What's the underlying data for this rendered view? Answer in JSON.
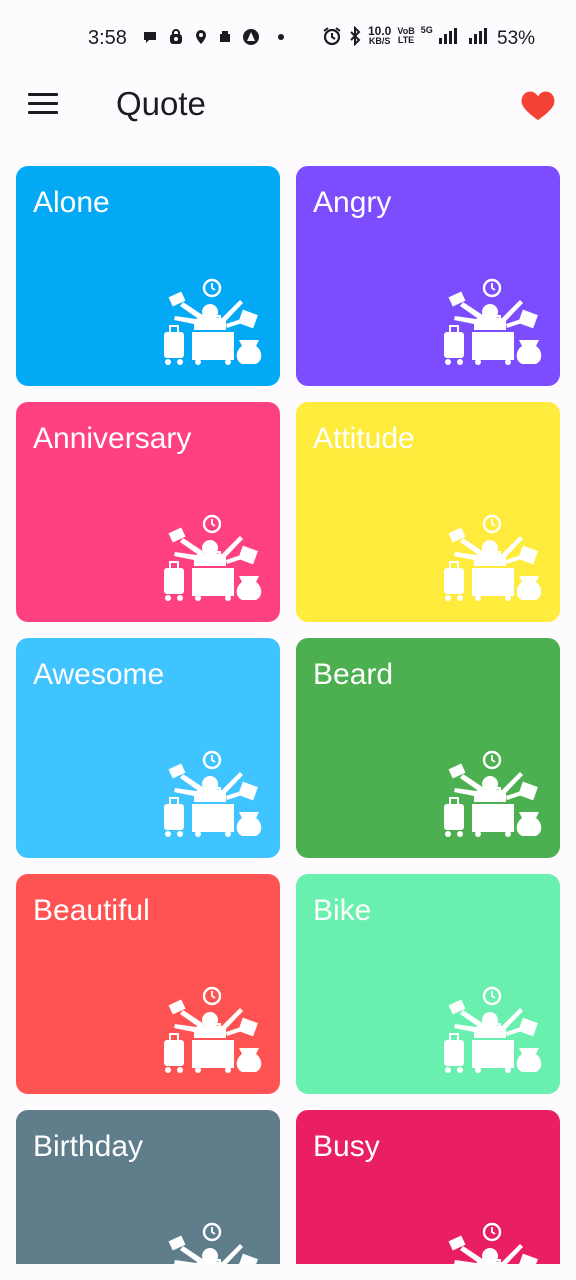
{
  "status_bar": {
    "time": "3:58",
    "net_speed_value": "10.0",
    "net_speed_unit": "KB/S",
    "volte_top": "VoB",
    "volte_bottom": "LTE",
    "network": "5G",
    "battery": "53%"
  },
  "app_bar": {
    "title": "Quote",
    "menu_icon": "hamburger-menu-icon",
    "favorite_icon": "heart-icon",
    "favorite_color": "#f44336"
  },
  "categories": [
    {
      "label": "Alone",
      "color": "#03a9f4"
    },
    {
      "label": "Angry",
      "color": "#7c4dff"
    },
    {
      "label": "Anniversary",
      "color": "#ff4081"
    },
    {
      "label": "Attitude",
      "color": "#ffeb3b"
    },
    {
      "label": "Awesome",
      "color": "#40c4ff"
    },
    {
      "label": "Beard",
      "color": "#4caf50"
    },
    {
      "label": "Beautiful",
      "color": "#ff5252"
    },
    {
      "label": "Bike",
      "color": "#69f0ae"
    },
    {
      "label": "Birthday",
      "color": "#607d8b"
    },
    {
      "label": "Busy",
      "color": "#e91e63"
    }
  ]
}
